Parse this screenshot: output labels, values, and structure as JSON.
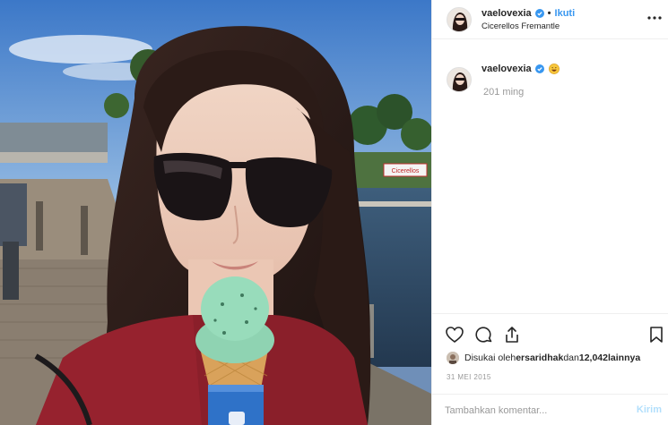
{
  "post": {
    "username": "vaelovexia",
    "follow_label": "Ikuti",
    "dot": "•",
    "location": "Cicerellos Fremantle",
    "verified_icon": "verified-badge-icon",
    "more_icon": "more-options-icon"
  },
  "caption": {
    "username": "vaelovexia",
    "emoji_icon": "grinning-face-emoji",
    "time": "201 ming"
  },
  "actions": {
    "icons": [
      "heart-icon",
      "comment-icon",
      "share-icon",
      "bookmark-icon"
    ]
  },
  "likes": {
    "prefix": "Disukai oleh ",
    "user": "ersaridhak",
    "middle": " dan ",
    "count": "12,042",
    "suffix": " lainnya"
  },
  "date": "31 MEI 2015",
  "comment": {
    "placeholder": "Tambahkan komentar...",
    "send_label": "Kirim"
  },
  "photo_sign_text": "Cicerellos",
  "colors": {
    "link": "#3897f0",
    "send_disabled": "#b2dffc",
    "verified": "#3897f0",
    "text_muted": "#999999"
  }
}
